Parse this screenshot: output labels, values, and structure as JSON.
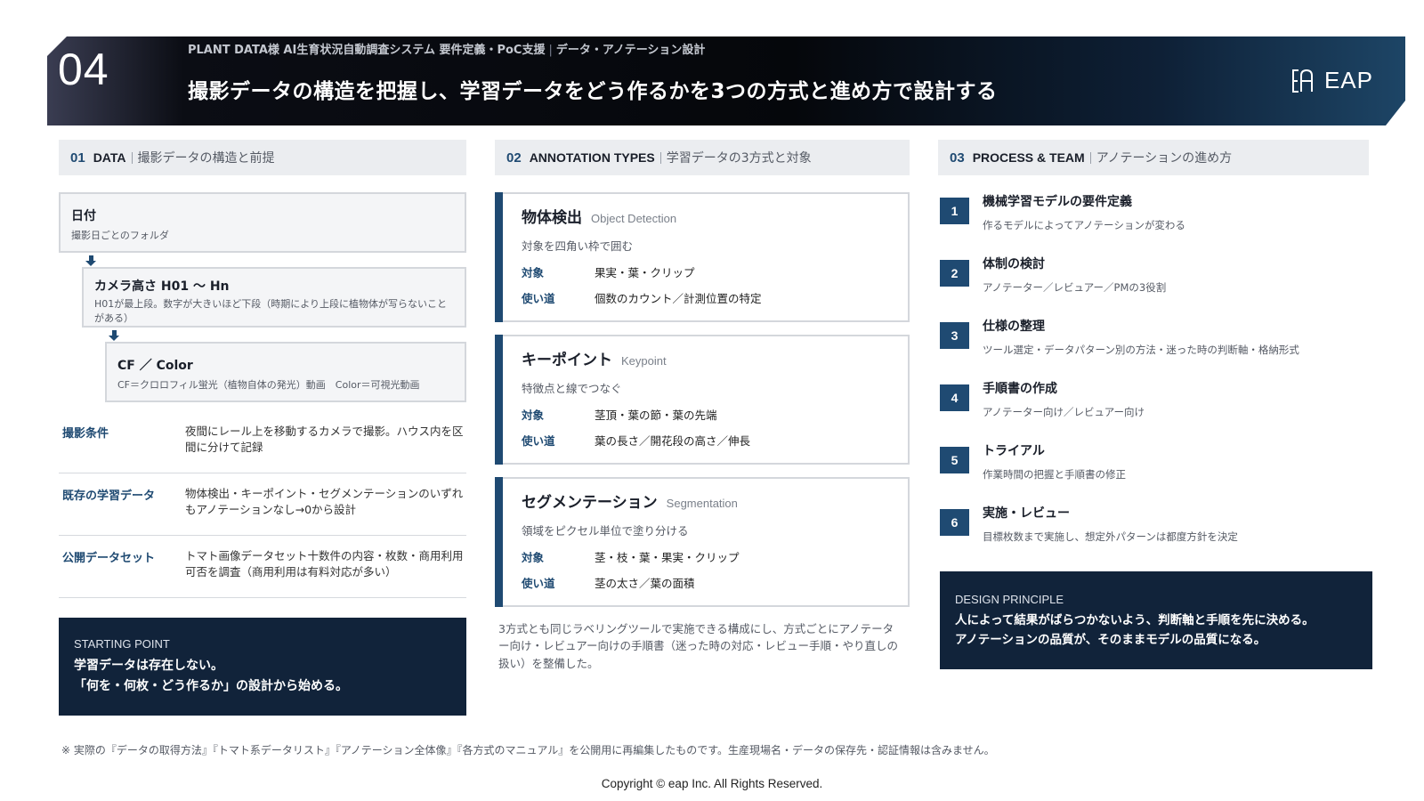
{
  "header": {
    "number": "04",
    "subtitle_main": "PLANT DATA様 AI生育状況自動調査システム 要件定義・PoC支援",
    "subtitle_sep": "|",
    "subtitle_section": "データ・アノテーション設計",
    "title": "撮影データの構造を把握し、学習データをどう作るかを3つの方式と進め方で設計する",
    "logo_text": "EAP"
  },
  "sections": {
    "data": {
      "num": "01",
      "en": "DATA",
      "jp": "撮影データの構造と前提"
    },
    "types": {
      "num": "02",
      "en": "ANNOTATION TYPES",
      "jp": "学習データの3方式と対象"
    },
    "process": {
      "num": "03",
      "en": "PROCESS & TEAM",
      "jp": "アノテーションの進め方"
    }
  },
  "folders": [
    {
      "title": "日付",
      "desc": "撮影日ごとのフォルダ"
    },
    {
      "title": "カメラ高さ H01 〜 Hn",
      "desc": "H01が最上段。数字が大きいほど下段（時期により上段に植物体が写らないことがある）"
    },
    {
      "title": "CF ／ Color",
      "desc": "CF＝クロロフィル蛍光（植物自体の発光）動画　Color＝可視光動画"
    }
  ],
  "conditions": [
    {
      "key": "撮影条件",
      "value": "夜間にレール上を移動するカメラで撮影。ハウス内を区間に分けて記録"
    },
    {
      "key": "既存の学習データ",
      "value": "物体検出・キーポイント・セグメンテーションのいずれもアノテーションなし→0から設計"
    },
    {
      "key": "公開データセット",
      "value": "トマト画像データセット十数件の内容・枚数・商用利用可否を調査（商用利用は有料対応が多い）"
    }
  ],
  "starting_point": {
    "label": "STARTING POINT",
    "line1": "学習データは存在しない。",
    "line2": "「何を・何枚・どう作るか」の設計から始める。"
  },
  "annotation_types": [
    {
      "name": "物体検出",
      "en": "Object Detection",
      "desc": "対象を四角い枠で囲む",
      "target_label": "対象",
      "target": "果実・葉・クリップ",
      "use_label": "使い道",
      "use": "個数のカウント／計測位置の特定"
    },
    {
      "name": "キーポイント",
      "en": "Keypoint",
      "desc": "特徴点と線でつなぐ",
      "target_label": "対象",
      "target": "茎頂・葉の節・葉の先端",
      "use_label": "使い道",
      "use": "葉の長さ／開花段の高さ／伸長"
    },
    {
      "name": "セグメンテーション",
      "en": "Segmentation",
      "desc": "領域をピクセル単位で塗り分ける",
      "target_label": "対象",
      "target": "茎・枝・葉・果実・クリップ",
      "use_label": "使い道",
      "use": "茎の太さ／葉の面積"
    }
  ],
  "types_note": "3方式とも同じラベリングツールで実施できる構成にし、方式ごとにアノテーター向け・レビュアー向けの手順書（迷った時の対応・レビュー手順・やり直しの扱い）を整備した。",
  "steps": [
    {
      "num": "1",
      "title": "機械学習モデルの要件定義",
      "desc": "作るモデルによってアノテーションが変わる"
    },
    {
      "num": "2",
      "title": "体制の検討",
      "desc": "アノテーター／レビュアー／PMの3役割"
    },
    {
      "num": "3",
      "title": "仕様の整理",
      "desc": "ツール選定・データパターン別の方法・迷った時の判断軸・格納形式"
    },
    {
      "num": "4",
      "title": "手順書の作成",
      "desc": "アノテーター向け／レビュアー向け"
    },
    {
      "num": "5",
      "title": "トライアル",
      "desc": "作業時間の把握と手順書の修正"
    },
    {
      "num": "6",
      "title": "実施・レビュー",
      "desc": "目標枚数まで実施し、想定外パターンは都度方針を決定"
    }
  ],
  "design_principle": {
    "label": "DESIGN PRINCIPLE",
    "line1": "人によって結果がばらつかないよう、判断軸と手順を先に決める。",
    "line2": "アノテーションの品質が、そのままモデルの品質になる。"
  },
  "footnote": "※ 実際の『データの取得方法』『トマト系データリスト』『アノテーション全体像』『各方式のマニュアル』を公開用に再編集したものです。生産現場名・データの保存先・認証情報は含みません。",
  "copyright": "Copyright © eap Inc. All Rights Reserved.",
  "colors": {
    "accent": "#1f4a72",
    "dark_panel": "#11233a",
    "section_bg": "#ebedf0"
  }
}
